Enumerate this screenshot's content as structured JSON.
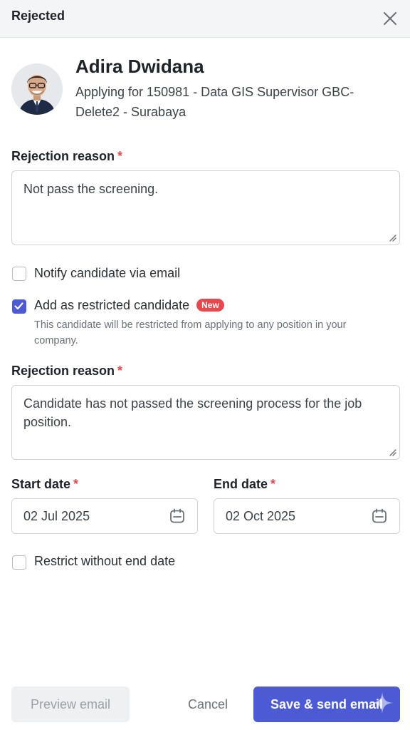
{
  "modal": {
    "title": "Rejected"
  },
  "candidate": {
    "name": "Adira Dwidana",
    "applying": "Applying for 150981 - Data GIS Supervisor GBC-Delete2 - Surabaya"
  },
  "rejection_reason_1": {
    "label": "Rejection reason",
    "required_mark": "*",
    "value": "Not pass the screening."
  },
  "notify": {
    "label": "Notify candidate via email",
    "checked": false
  },
  "restricted": {
    "label": "Add as restricted candidate",
    "badge": "New",
    "checked": true,
    "helper": "This candidate will be restricted from applying to any position in your company."
  },
  "rejection_reason_2": {
    "label": "Rejection reason",
    "required_mark": "*",
    "value": "Candidate has not passed the screening process for the job position."
  },
  "start_date": {
    "label": "Start date",
    "required_mark": "*",
    "value": "02 Jul 2025"
  },
  "end_date": {
    "label": "End date",
    "required_mark": "*",
    "value": "02 Oct 2025"
  },
  "no_end_date": {
    "label": "Restrict without end date",
    "checked": false
  },
  "footer": {
    "preview_label": "Preview email",
    "cancel_label": "Cancel",
    "save_label": "Save & send email"
  },
  "icons": {
    "close": "close-icon",
    "calendar": "calendar-icon",
    "check": "checkmark-icon",
    "resize": "resize-grip-icon",
    "sparkle": "sparkle-icon"
  },
  "colors": {
    "primary": "#4c5bd4",
    "required": "#e5484d",
    "badge": "#e5484d",
    "header_bg": "#f4f5f7"
  }
}
